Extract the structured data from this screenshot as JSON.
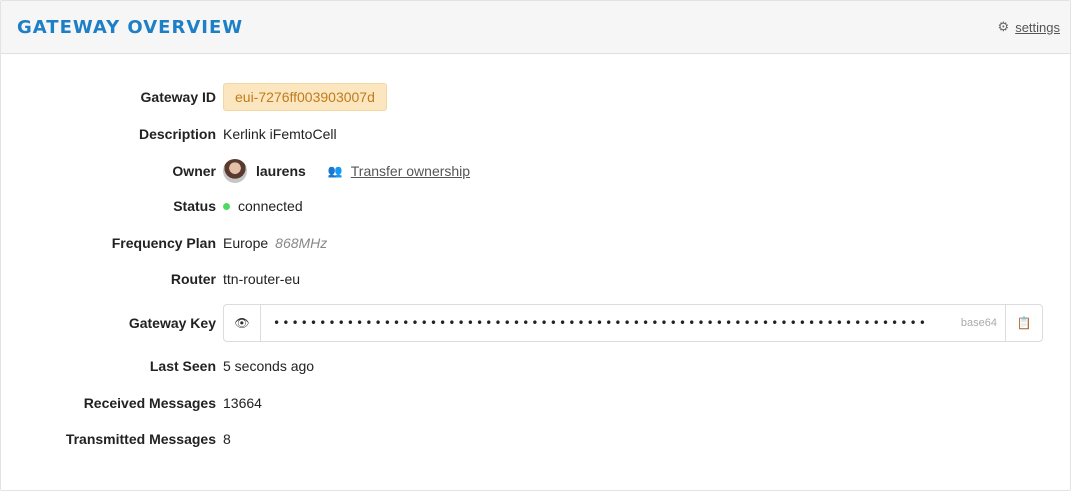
{
  "header": {
    "title": "GATEWAY OVERVIEW",
    "settings_label": "settings",
    "settings_icon": "gear-icon"
  },
  "labels": {
    "gateway_id": "Gateway ID",
    "description": "Description",
    "owner": "Owner",
    "status": "Status",
    "frequency_plan": "Frequency Plan",
    "router": "Router",
    "gateway_key": "Gateway Key",
    "last_seen": "Last Seen",
    "received_messages": "Received Messages",
    "transmitted_messages": "Transmitted Messages"
  },
  "values": {
    "gateway_id": "eui-7276ff003903007d",
    "description": "Kerlink iFemtoCell",
    "owner": "laurens",
    "transfer_label": "Transfer ownership",
    "status": "connected",
    "status_color": "#4cd964",
    "frequency_plan": "Europe",
    "frequency_band": "868MHz",
    "router": "ttn-router-eu",
    "gateway_key_masked": "•••••••••••••••••••••••••••••••••••••••••••••••••••••••••••••••••••••••",
    "gateway_key_format": "base64",
    "last_seen": "5 seconds ago",
    "received_messages": "13664",
    "transmitted_messages": "8"
  },
  "colors": {
    "title": "#1d7fc5",
    "badge_bg": "#fbe6bf",
    "badge_text": "#c27b1b"
  }
}
